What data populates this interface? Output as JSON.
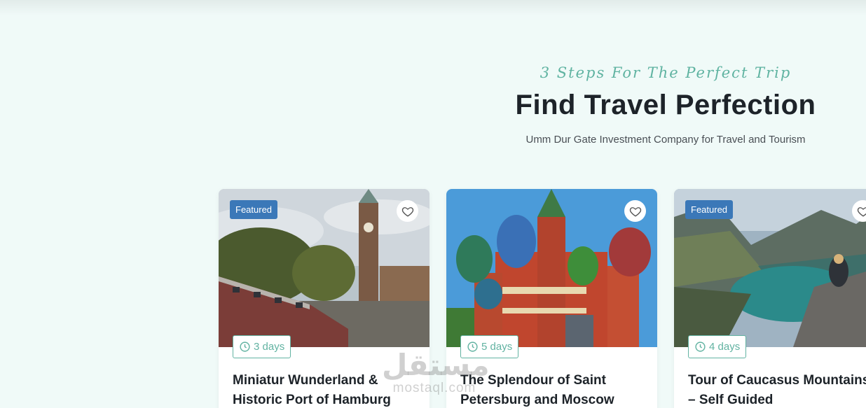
{
  "section": {
    "tagline": "3 Steps For The Perfect Trip",
    "heading": "Find Travel Perfection",
    "subheading": "Umm Dur Gate Investment Company for Travel and Tourism"
  },
  "tours": [
    {
      "badge": "Featured",
      "duration": "3 days",
      "title": "Miniatur Wunderland & Historic Port of Hamburg"
    },
    {
      "badge": "",
      "duration": "5 days",
      "title": "The Splendour of Saint Petersburg and Moscow"
    },
    {
      "badge": "Featured",
      "duration": "4 days",
      "title": "Tour of Caucasus Mountains – Self Guided"
    }
  ],
  "icons": {
    "favorite": "heart-icon",
    "duration": "clock-icon"
  },
  "colors": {
    "background": "#f0faf8",
    "accent": "#62b3a2",
    "badge": "#3b78b8",
    "heading": "#1d2329"
  },
  "watermark": {
    "arabic": "مستقل",
    "latin": "mostaql.com"
  }
}
